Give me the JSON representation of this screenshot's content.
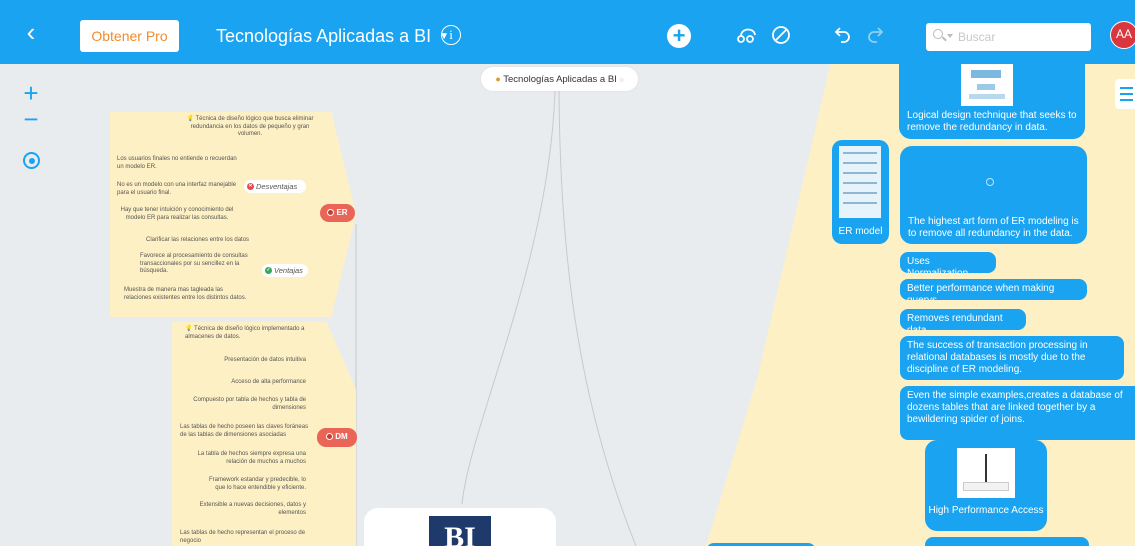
{
  "toolbar": {
    "back_glyph": "‹",
    "pro_label": "Obtener Pro",
    "title": "Tecnologías Aplicadas a BI",
    "info_glyph": "i",
    "add_glyph": "+",
    "search_placeholder": "Buscar",
    "avatar_initials": "AA",
    "icons": [
      "back-icon",
      "info-icon",
      "add-icon",
      "connect-icon",
      "no-entry-icon",
      "undo-icon",
      "redo-icon",
      "search-icon"
    ]
  },
  "canvas_controls": {
    "zoom_in": "+",
    "zoom_out": "−"
  },
  "root_pill": {
    "label": "Tecnologías Aplicadas a BI"
  },
  "left_branches": {
    "er": {
      "label": "ER",
      "definition": "Técnica de diseño lógico que busca eliminar redundancia en los datos de pequeño y gran volumen.",
      "desventajas": {
        "label": "Desventajas",
        "items": [
          "Los usuarios finales no entiende o recuerdan un modelo ER.",
          "No es un modelo con una interfaz manejable para el usuario final.",
          "Hay que tener intuición y conocimiento del modelo ER para realizar las consultas."
        ]
      },
      "ventajas": {
        "label": "Ventajas",
        "items": [
          "Clarificar las relaciones entre los datos",
          "Favorece al procesamiento de consultas transaccionales por su sencillez en la búsqueda.",
          "Muestra de manera mas tagleada las relaciones existentes entre los distintos datos."
        ]
      }
    },
    "dm": {
      "label": "DM",
      "definition": "Técnica de diseño lógico implementado a almacenes de datos.",
      "items": [
        "Presentación de datos intuitiva",
        "Acceso de alta performance",
        "Compuesto por tabla de hechos y tabla de dimensiones",
        "Las tablas de hecho poseen las claves foráneas de las tablas de dimensiones asociadas",
        "La tabla de hechos siempre expresa una relación de muchos a muchos",
        "Framework estandar y predecible, lo que lo hace entendible y eficiente.",
        "Extensible a nuevas decisiones, datos y elementos",
        "Las tablas de hecho representan el proceso de negocio"
      ]
    }
  },
  "center_card": {
    "logo_text": "BI"
  },
  "right_panel": {
    "er_model_label": "ER model",
    "nodes": [
      "Logical design technique that seeks to remove the redundancy in data.",
      "The highest art form of ER modeling is to remove all redundancy in the data.",
      "Uses Normalization",
      "Better performance when making querys",
      "Removes rendundant data",
      "The success of transaction processing in relational databases is mostly due to the discipline of ER modeling.",
      "Even the simple examples,creates a database of dozens tables that are linked together by a bewildering spider of joins."
    ],
    "high_performance_label": "High Performance Access"
  },
  "colors": {
    "toolbar": "#1aa3f0",
    "canvas": "#e9ecef",
    "branch_yellow": "#fdf0c4",
    "node_blue": "#1aa3f0",
    "node_red": "#e86558",
    "pro_orange": "#f28b2e",
    "avatar_red": "#d9363e"
  }
}
